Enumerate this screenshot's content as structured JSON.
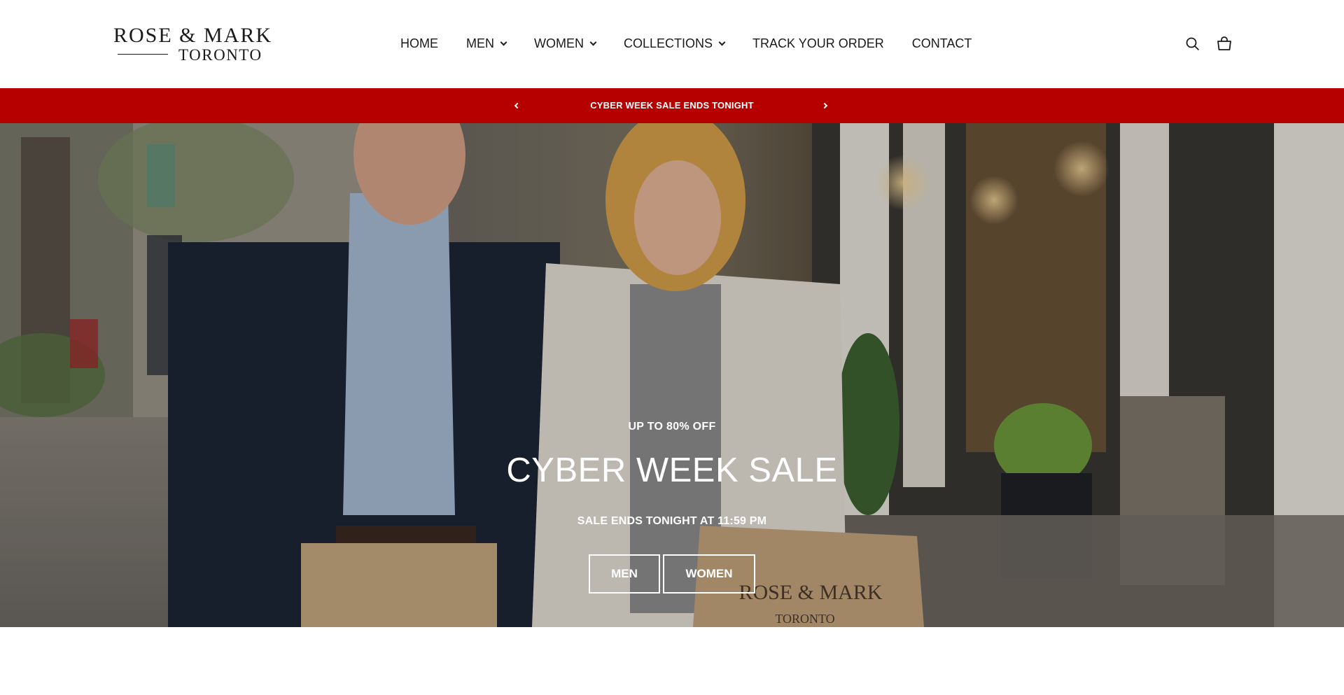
{
  "header": {
    "logo": {
      "line1": "ROSE & MARK",
      "line2": "TORONTO"
    },
    "nav": [
      {
        "label": "HOME",
        "dropdown": false
      },
      {
        "label": "MEN",
        "dropdown": true
      },
      {
        "label": "WOMEN",
        "dropdown": true
      },
      {
        "label": "COLLECTIONS",
        "dropdown": true
      },
      {
        "label": "TRACK YOUR ORDER",
        "dropdown": false
      },
      {
        "label": "CONTACT",
        "dropdown": false
      }
    ],
    "icons": {
      "search": "search-icon",
      "cart": "cart-icon"
    }
  },
  "announcement": {
    "text": "CYBER WEEK SALE ENDS TONIGHT",
    "background": "#b60000",
    "icons": {
      "prev": "chevron-left-icon",
      "next": "chevron-right-icon"
    }
  },
  "hero": {
    "eyebrow": "UP TO 80% OFF",
    "title": "CYBER WEEK SALE",
    "subtitle": "SALE ENDS TONIGHT AT 11:59 PM",
    "buttons": {
      "men": "MEN",
      "women": "WOMEN"
    },
    "bag_print": {
      "line1": "ROSE & MARK",
      "line2": "TORONTO"
    }
  }
}
